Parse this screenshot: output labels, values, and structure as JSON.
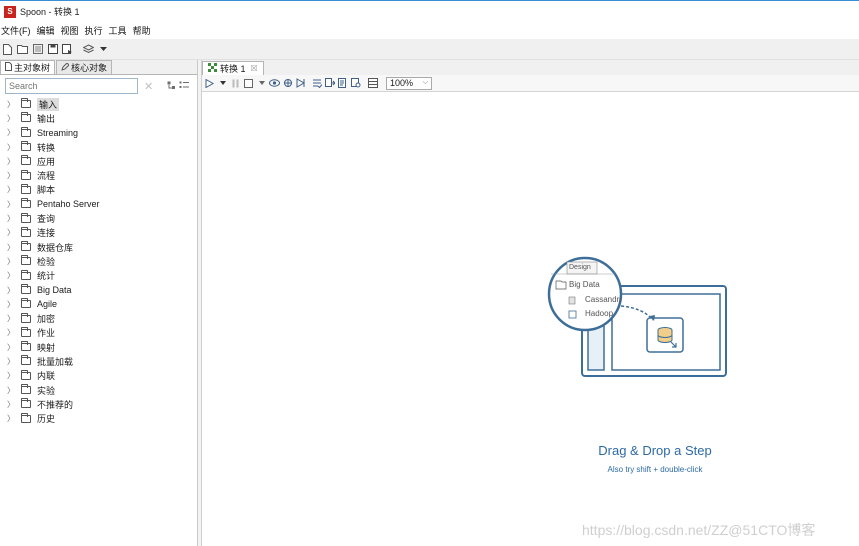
{
  "window": {
    "app_logo_text": "S",
    "title": "Spoon - 转换 1"
  },
  "menu": [
    "文件(F)",
    "编辑",
    "视图",
    "执行",
    "工具",
    "帮助"
  ],
  "toolbar_icons": [
    "new-file-icon",
    "open-folder-icon",
    "explore-repository-icon",
    "save-icon",
    "save-as-icon",
    "perspective-layers-icon",
    "perspective-dropdown-icon"
  ],
  "left_panel": {
    "tabs": [
      {
        "label": "主对象树",
        "icon": "document-icon"
      },
      {
        "label": "核心对象",
        "icon": "pencil-icon"
      }
    ],
    "search": {
      "value": "",
      "placeholder": "Search"
    },
    "tree_items": [
      "输入",
      "输出",
      "Streaming",
      "转换",
      "应用",
      "流程",
      "脚本",
      "Pentaho Server",
      "查询",
      "连接",
      "数据仓库",
      "检验",
      "统计",
      "Big Data",
      "Agile",
      "加密",
      "作业",
      "映射",
      "批量加载",
      "内联",
      "实验",
      "不推荐的",
      "历史"
    ],
    "selected_item": "输入"
  },
  "editor": {
    "tab_label": "转换 1",
    "tab_close": "☒",
    "zoom": "100%"
  },
  "canvas": {
    "help_panel_tab": "Design",
    "help_folder": "Big Data",
    "help_item_1": "Cassandra",
    "help_item_2": "Hadoop",
    "title": "Drag & Drop a Step",
    "subtitle": "Also try shift + double-click"
  },
  "watermark": "https://blog.csdn.net/ZZ@51CTO博客",
  "colors": {
    "accent_blue": "#2c6aa5",
    "logo_red": "#c8231c",
    "illustration_blue": "#3d6e99"
  }
}
